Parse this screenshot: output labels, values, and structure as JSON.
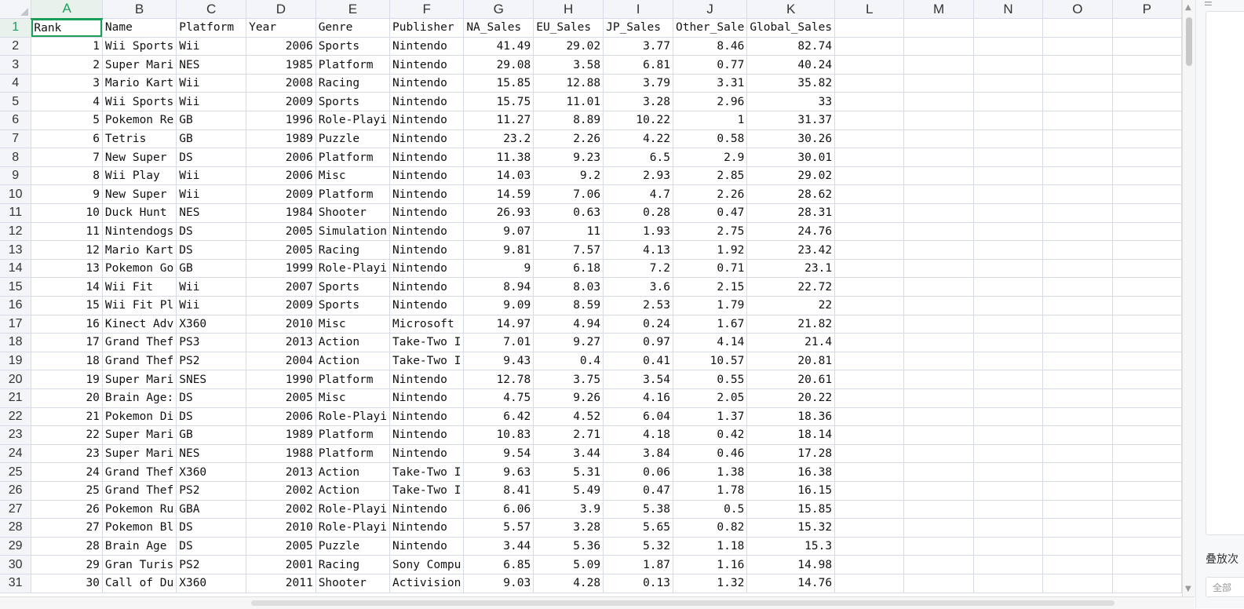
{
  "sheet": {
    "columns": [
      "A",
      "B",
      "C",
      "D",
      "E",
      "F",
      "G",
      "H",
      "I",
      "J",
      "K",
      "L",
      "M",
      "N",
      "O",
      "P"
    ],
    "active_column": "A",
    "active_row": 1,
    "header_row": [
      "Rank",
      "Name",
      "Platform",
      "Year",
      "Genre",
      "Publisher",
      "NA_Sales",
      "EU_Sales",
      "JP_Sales",
      "Other_Sale",
      "Global_Sales"
    ],
    "rows": [
      [
        "1",
        "Wii Sports",
        "Wii",
        "2006",
        "Sports",
        "Nintendo",
        "41.49",
        "29.02",
        "3.77",
        "8.46",
        "82.74"
      ],
      [
        "2",
        "Super Mari",
        "NES",
        "1985",
        "Platform",
        "Nintendo",
        "29.08",
        "3.58",
        "6.81",
        "0.77",
        "40.24"
      ],
      [
        "3",
        "Mario Kart",
        "Wii",
        "2008",
        "Racing",
        "Nintendo",
        "15.85",
        "12.88",
        "3.79",
        "3.31",
        "35.82"
      ],
      [
        "4",
        "Wii Sports",
        "Wii",
        "2009",
        "Sports",
        "Nintendo",
        "15.75",
        "11.01",
        "3.28",
        "2.96",
        "33"
      ],
      [
        "5",
        "Pokemon Re",
        "GB",
        "1996",
        "Role-Playi",
        "Nintendo",
        "11.27",
        "8.89",
        "10.22",
        "1",
        "31.37"
      ],
      [
        "6",
        "Tetris",
        "GB",
        "1989",
        "Puzzle",
        "Nintendo",
        "23.2",
        "2.26",
        "4.22",
        "0.58",
        "30.26"
      ],
      [
        "7",
        "New Super",
        "DS",
        "2006",
        "Platform",
        "Nintendo",
        "11.38",
        "9.23",
        "6.5",
        "2.9",
        "30.01"
      ],
      [
        "8",
        "Wii Play",
        "Wii",
        "2006",
        "Misc",
        "Nintendo",
        "14.03",
        "9.2",
        "2.93",
        "2.85",
        "29.02"
      ],
      [
        "9",
        "New Super",
        "Wii",
        "2009",
        "Platform",
        "Nintendo",
        "14.59",
        "7.06",
        "4.7",
        "2.26",
        "28.62"
      ],
      [
        "10",
        "Duck Hunt",
        "NES",
        "1984",
        "Shooter",
        "Nintendo",
        "26.93",
        "0.63",
        "0.28",
        "0.47",
        "28.31"
      ],
      [
        "11",
        "Nintendogs",
        "DS",
        "2005",
        "Simulation",
        "Nintendo",
        "9.07",
        "11",
        "1.93",
        "2.75",
        "24.76"
      ],
      [
        "12",
        "Mario Kart",
        "DS",
        "2005",
        "Racing",
        "Nintendo",
        "9.81",
        "7.57",
        "4.13",
        "1.92",
        "23.42"
      ],
      [
        "13",
        "Pokemon Go",
        "GB",
        "1999",
        "Role-Playi",
        "Nintendo",
        "9",
        "6.18",
        "7.2",
        "0.71",
        "23.1"
      ],
      [
        "14",
        "Wii Fit",
        "Wii",
        "2007",
        "Sports",
        "Nintendo",
        "8.94",
        "8.03",
        "3.6",
        "2.15",
        "22.72"
      ],
      [
        "15",
        "Wii Fit Pl",
        "Wii",
        "2009",
        "Sports",
        "Nintendo",
        "9.09",
        "8.59",
        "2.53",
        "1.79",
        "22"
      ],
      [
        "16",
        "Kinect Adv",
        "X360",
        "2010",
        "Misc",
        "Microsoft",
        "14.97",
        "4.94",
        "0.24",
        "1.67",
        "21.82"
      ],
      [
        "17",
        "Grand Thef",
        "PS3",
        "2013",
        "Action",
        "Take-Two I",
        "7.01",
        "9.27",
        "0.97",
        "4.14",
        "21.4"
      ],
      [
        "18",
        "Grand Thef",
        "PS2",
        "2004",
        "Action",
        "Take-Two I",
        "9.43",
        "0.4",
        "0.41",
        "10.57",
        "20.81"
      ],
      [
        "19",
        "Super Mari",
        "SNES",
        "1990",
        "Platform",
        "Nintendo",
        "12.78",
        "3.75",
        "3.54",
        "0.55",
        "20.61"
      ],
      [
        "20",
        "Brain Age:",
        "DS",
        "2005",
        "Misc",
        "Nintendo",
        "4.75",
        "9.26",
        "4.16",
        "2.05",
        "20.22"
      ],
      [
        "21",
        "Pokemon Di",
        "DS",
        "2006",
        "Role-Playi",
        "Nintendo",
        "6.42",
        "4.52",
        "6.04",
        "1.37",
        "18.36"
      ],
      [
        "22",
        "Super Mari",
        "GB",
        "1989",
        "Platform",
        "Nintendo",
        "10.83",
        "2.71",
        "4.18",
        "0.42",
        "18.14"
      ],
      [
        "23",
        "Super Mari",
        "NES",
        "1988",
        "Platform",
        "Nintendo",
        "9.54",
        "3.44",
        "3.84",
        "0.46",
        "17.28"
      ],
      [
        "24",
        "Grand Thef",
        "X360",
        "2013",
        "Action",
        "Take-Two I",
        "9.63",
        "5.31",
        "0.06",
        "1.38",
        "16.38"
      ],
      [
        "25",
        "Grand Thef",
        "PS2",
        "2002",
        "Action",
        "Take-Two I",
        "8.41",
        "5.49",
        "0.47",
        "1.78",
        "16.15"
      ],
      [
        "26",
        "Pokemon Ru",
        "GBA",
        "2002",
        "Role-Playi",
        "Nintendo",
        "6.06",
        "3.9",
        "5.38",
        "0.5",
        "15.85"
      ],
      [
        "27",
        "Pokemon Bl",
        "DS",
        "2010",
        "Role-Playi",
        "Nintendo",
        "5.57",
        "3.28",
        "5.65",
        "0.82",
        "15.32"
      ],
      [
        "28",
        "Brain Age",
        "DS",
        "2005",
        "Puzzle",
        "Nintendo",
        "3.44",
        "5.36",
        "5.32",
        "1.18",
        "15.3"
      ],
      [
        "29",
        "Gran Turis",
        "PS2",
        "2001",
        "Racing",
        "Sony Compu",
        "6.85",
        "5.09",
        "1.87",
        "1.16",
        "14.98"
      ],
      [
        "30",
        "Call of Du",
        "X360",
        "2011",
        "Shooter",
        "Activision",
        "9.03",
        "4.28",
        "0.13",
        "1.32",
        "14.76"
      ]
    ]
  },
  "side_panel": {
    "label": "叠放次",
    "field_placeholder": "全部"
  },
  "colors": {
    "accent": "#1a9e5a",
    "grid": "#d6dbe8",
    "header_bg": "#f3f5f9"
  },
  "icons": {
    "corner": "select-all-triangle-icon",
    "scroll_up": "caret-up-icon",
    "scroll_down": "caret-down-icon",
    "menu": "menu-icon"
  }
}
